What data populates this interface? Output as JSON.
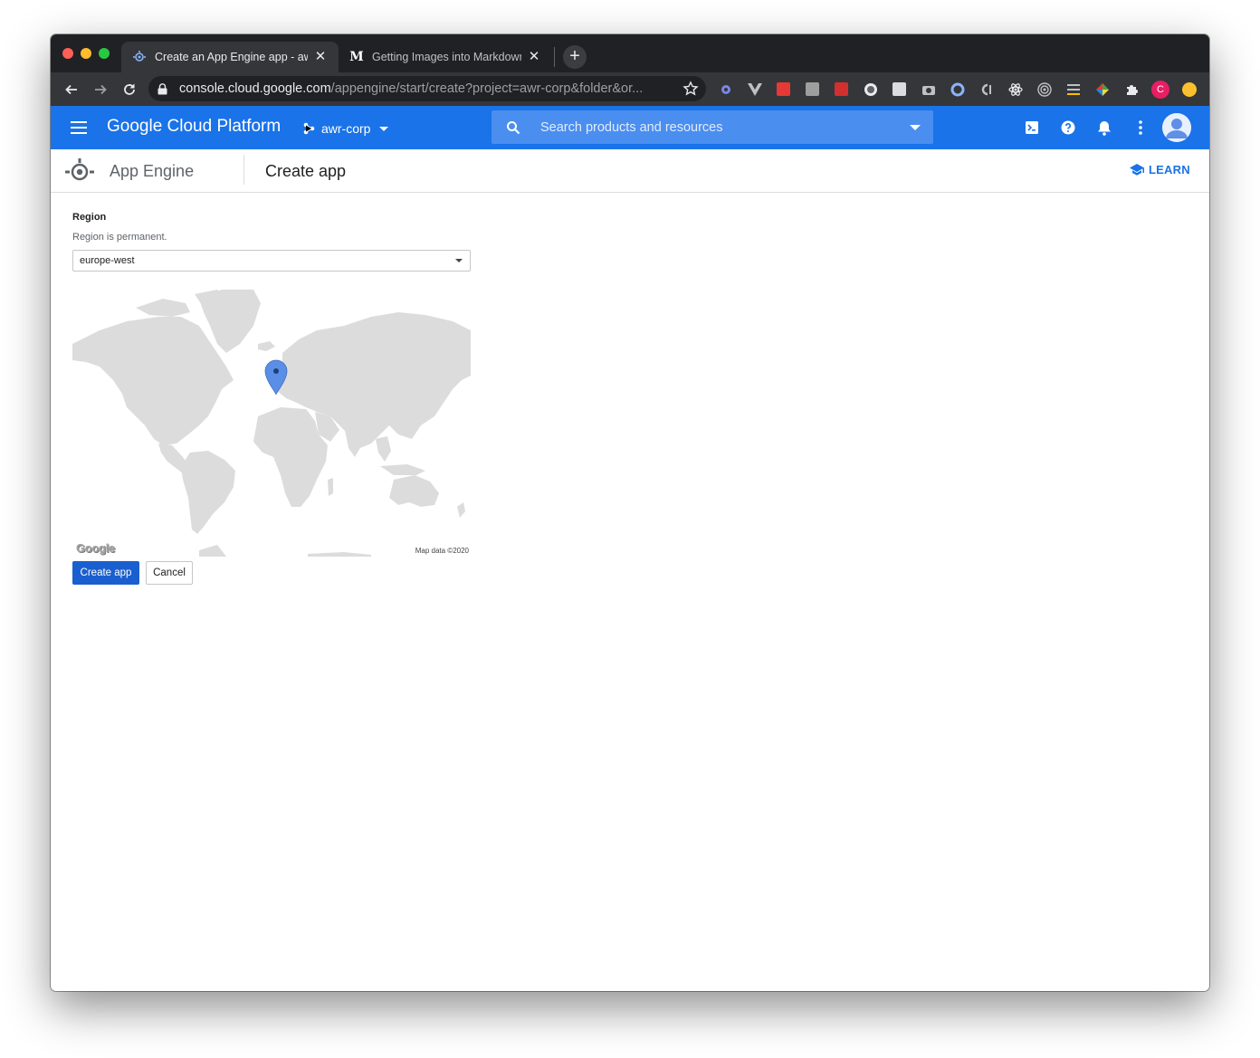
{
  "browser": {
    "tabs": [
      {
        "title": "Create an App Engine app - aw",
        "favicon": "app-engine-icon",
        "active": true
      },
      {
        "title": "Getting Images into Markdown",
        "favicon": "medium-icon",
        "favicon_glyph": "M",
        "active": false
      }
    ],
    "new_tab_glyph": "+",
    "close_glyph": "✕",
    "url_host": "console.cloud.google.com",
    "url_path": "/appengine/start/create?project=awr-corp&folder&or...",
    "profile_initial": "C"
  },
  "header": {
    "logo_text": "Google Cloud Platform",
    "project": "awr-corp",
    "search_placeholder": "Search products and resources"
  },
  "subheader": {
    "product": "App Engine",
    "page_title": "Create app",
    "learn_label": "LEARN"
  },
  "form": {
    "region_label": "Region",
    "region_help": "Region is permanent.",
    "region_value": "europe-west"
  },
  "map": {
    "attribution": "Map data ©2020",
    "logo": "Google",
    "marker_region": "europe-west"
  },
  "actions": {
    "create_label": "Create app",
    "cancel_label": "Cancel"
  },
  "colors": {
    "brand_blue": "#1a73e8",
    "primary_button": "#1a5fcf",
    "land": "#dcdcdc",
    "marker": "#5b8ee6"
  }
}
